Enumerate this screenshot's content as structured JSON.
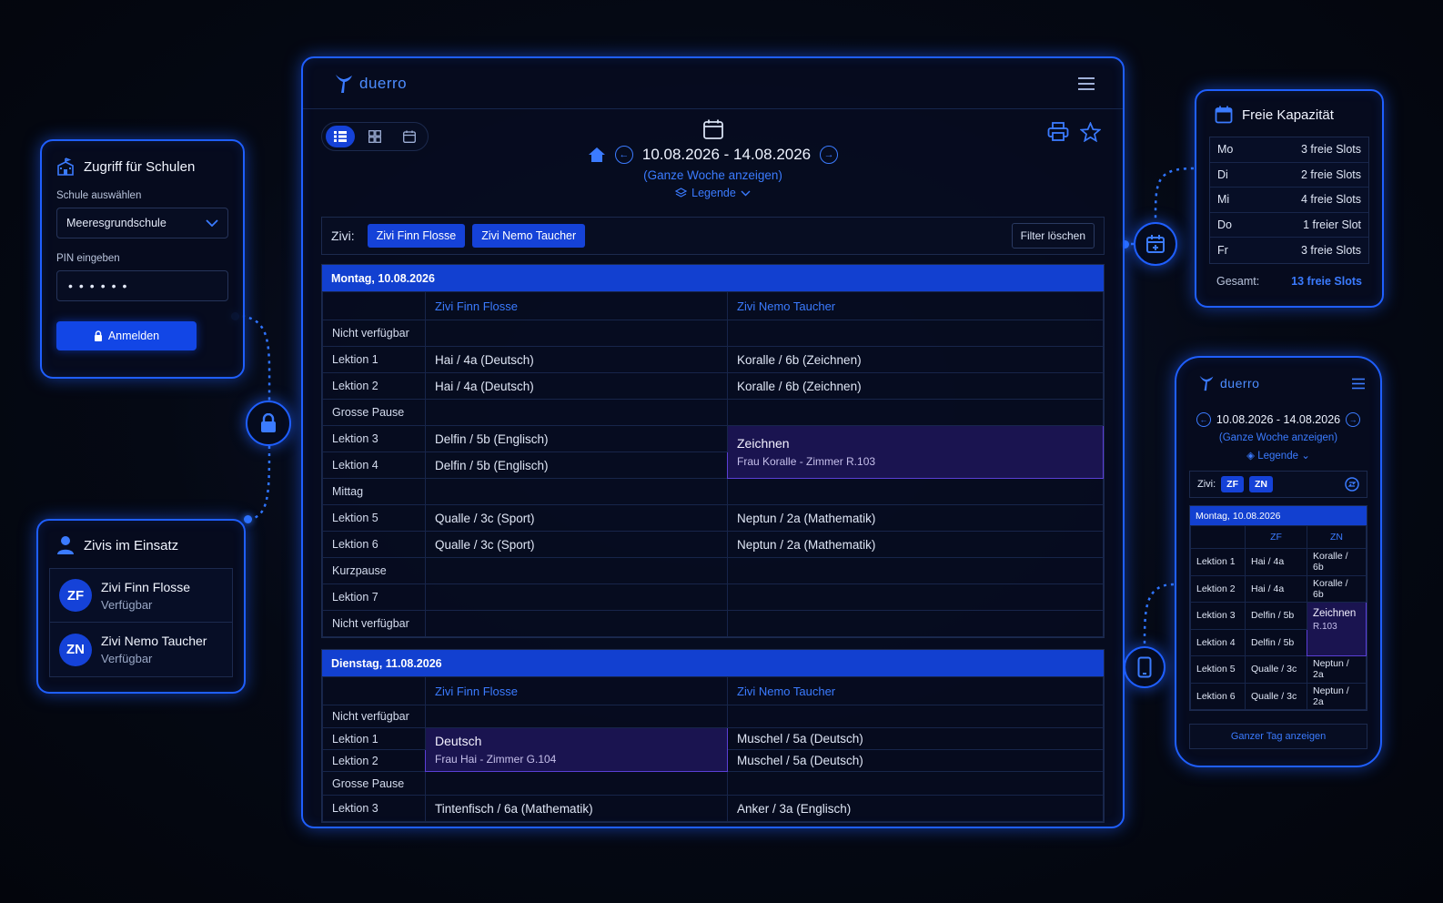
{
  "login": {
    "title": "Zugriff für Schulen",
    "school_label": "Schule auswählen",
    "school_value": "Meeresgrundschule",
    "pin_label": "PIN eingeben",
    "pin_value": "••••••",
    "submit_label": "Anmelden"
  },
  "zivis": {
    "title": "Zivis im Einsatz",
    "items": [
      {
        "initials": "ZF",
        "name": "Zivi Finn Flosse",
        "status": "Verfügbar"
      },
      {
        "initials": "ZN",
        "name": "Zivi Nemo Taucher",
        "status": "Verfügbar"
      }
    ]
  },
  "app": {
    "brand": "duerro",
    "date_range": "10.08.2026 - 14.08.2026",
    "week_link": "(Ganze Woche anzeigen)",
    "legend": "Legende",
    "filter": {
      "label": "Zivi:",
      "chips": [
        "Zivi Finn Flosse",
        "Zivi Nemo Taucher"
      ],
      "clear": "Filter löschen"
    },
    "days": [
      {
        "header": "Montag, 10.08.2026",
        "col1": "Zivi Finn Flosse",
        "col2": "Zivi Nemo Taucher",
        "rows": [
          {
            "label": "Nicht verfügbar",
            "a": "",
            "b": ""
          },
          {
            "label": "Lektion 1",
            "a": "Hai / 4a (Deutsch)",
            "b": "Koralle / 6b (Zeichnen)"
          },
          {
            "label": "Lektion 2",
            "a": "Hai / 4a (Deutsch)",
            "b": "Koralle / 6b (Zeichnen)"
          },
          {
            "label": "Grosse Pause",
            "a": "",
            "b": ""
          },
          {
            "label": "Lektion 3",
            "a": "Delfin / 5b (Englisch)",
            "b": ""
          },
          {
            "label": "Lektion 4",
            "a": "Delfin / 5b (Englisch)",
            "b": ""
          },
          {
            "label": "Mittag",
            "a": "",
            "b": ""
          },
          {
            "label": "Lektion 5",
            "a": "Qualle / 3c (Sport)",
            "b": "Neptun / 2a (Mathematik)"
          },
          {
            "label": "Lektion 6",
            "a": "Qualle / 3c (Sport)",
            "b": "Neptun / 2a (Mathematik)"
          },
          {
            "label": "Kurzpause",
            "a": "",
            "b": ""
          },
          {
            "label": "Lektion 7",
            "a": "",
            "b": ""
          },
          {
            "label": "Nicht verfügbar",
            "a": "",
            "b": ""
          }
        ],
        "highlight": {
          "title": "Zeichnen",
          "sub": "Frau Koralle - Zimmer R.103"
        }
      },
      {
        "header": "Dienstag, 11.08.2026",
        "col1": "Zivi Finn Flosse",
        "col2": "Zivi Nemo Taucher",
        "rows": [
          {
            "label": "Nicht verfügbar",
            "a": "",
            "b": ""
          },
          {
            "label": "Lektion 1",
            "a": "",
            "b": "Muschel / 5a (Deutsch)"
          },
          {
            "label": "Lektion 2",
            "a": "",
            "b": "Muschel / 5a (Deutsch)"
          },
          {
            "label": "Grosse Pause",
            "a": "",
            "b": ""
          },
          {
            "label": "Lektion 3",
            "a": "Tintenfisch / 6a (Mathematik)",
            "b": "Anker / 3a (Englisch)"
          }
        ],
        "highlight": {
          "title": "Deutsch",
          "sub": "Frau Hai - Zimmer G.104"
        }
      }
    ]
  },
  "capacity": {
    "title": "Freie Kapazität",
    "rows": [
      {
        "day": "Mo",
        "value": "3 freie Slots"
      },
      {
        "day": "Di",
        "value": "2 freie Slots"
      },
      {
        "day": "Mi",
        "value": "4 freie Slots"
      },
      {
        "day": "Do",
        "value": "1 freier Slot"
      },
      {
        "day": "Fr",
        "value": "3 freie Slots"
      }
    ],
    "total_label": "Gesamt:",
    "total_value": "13 freie Slots"
  },
  "mobile": {
    "brand": "duerro",
    "date_range": "10.08.2026 - 14.08.2026",
    "week_link": "(Ganze Woche anzeigen)",
    "legend": "Legende",
    "filter_label": "Zivi:",
    "chips": [
      "ZF",
      "ZN"
    ],
    "day_header": "Montag, 10.08.2026",
    "col1": "ZF",
    "col2": "ZN",
    "rows": [
      {
        "label": "Lektion 1",
        "a": "Hai / 4a",
        "b": "Koralle / 6b"
      },
      {
        "label": "Lektion 2",
        "a": "Hai / 4a",
        "b": "Koralle / 6b"
      },
      {
        "label": "Lektion 3",
        "a": "Delfin / 5b",
        "b": ""
      },
      {
        "label": "Lektion 4",
        "a": "Delfin / 5b",
        "b": ""
      },
      {
        "label": "Lektion 5",
        "a": "Qualle / 3c",
        "b": "Neptun / 2a"
      },
      {
        "label": "Lektion 6",
        "a": "Qualle / 3c",
        "b": "Neptun / 2a"
      }
    ],
    "highlight": {
      "title": "Zeichnen",
      "sub": "R.103"
    },
    "full_day": "Ganzer Tag anzeigen"
  },
  "colors": {
    "accent": "#1f5fff",
    "chip": "#1542d8",
    "highlight": "#1a1450"
  }
}
